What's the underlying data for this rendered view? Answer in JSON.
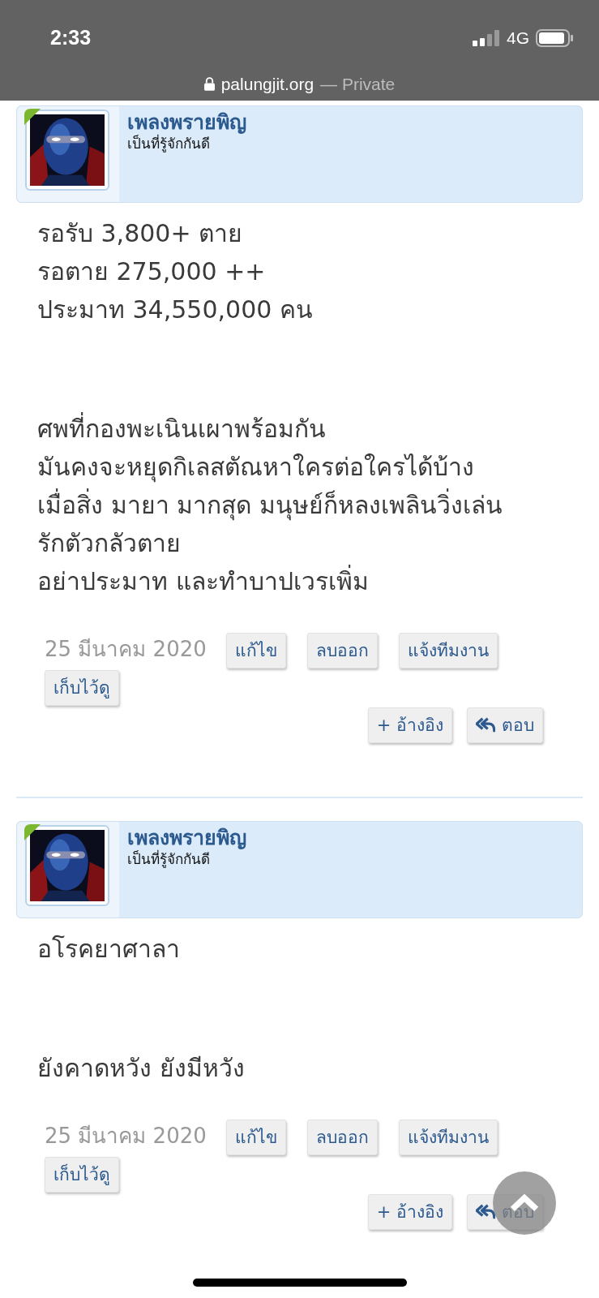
{
  "status_bar": {
    "time": "2:33",
    "network": "4G"
  },
  "address_bar": {
    "domain": "palungjit.org",
    "mode": "— Private"
  },
  "posts": [
    {
      "author": "เพลงพรายพิญ",
      "rank": "เป็นที่รู้จักกันดี",
      "paragraphs": [
        [
          "รอรับ 3,800+ ตาย",
          "รอตาย 275,000 ++",
          "ประมาท 34,550,000 คน"
        ],
        [
          "ศพที่กองพะเนินเผาพร้อมกัน",
          "มันคงจะหยุดกิเลสตัณหาใครต่อใครได้บ้าง",
          "เมื่อสิ่ง มายา มากสุด มนุษย์ก็หลงเพลินวิ่งเล่น",
          "รักตัวกลัวตาย",
          "อย่าประมาท และทำบาปเวรเพิ่ม"
        ]
      ],
      "date": "25 มีนาคม 2020",
      "actions": [
        "แก้ไข",
        "ลบออก",
        "แจ้งทีมงาน",
        "เก็บไว้ดู"
      ],
      "quote": "+ อ้างอิง",
      "reply": "ตอบ"
    },
    {
      "author": "เพลงพรายพิญ",
      "rank": "เป็นที่รู้จักกันดี",
      "paragraphs": [
        [
          "อโรคยาศาลา"
        ],
        [
          "ยังคาดหวัง ยังมีหวัง"
        ]
      ],
      "date": "25 มีนาคม 2020",
      "actions": [
        "แก้ไข",
        "ลบออก",
        "แจ้งทีมงาน",
        "เก็บไว้ดู"
      ],
      "quote": "+ อ้างอิง",
      "reply": "ตอบ"
    }
  ]
}
